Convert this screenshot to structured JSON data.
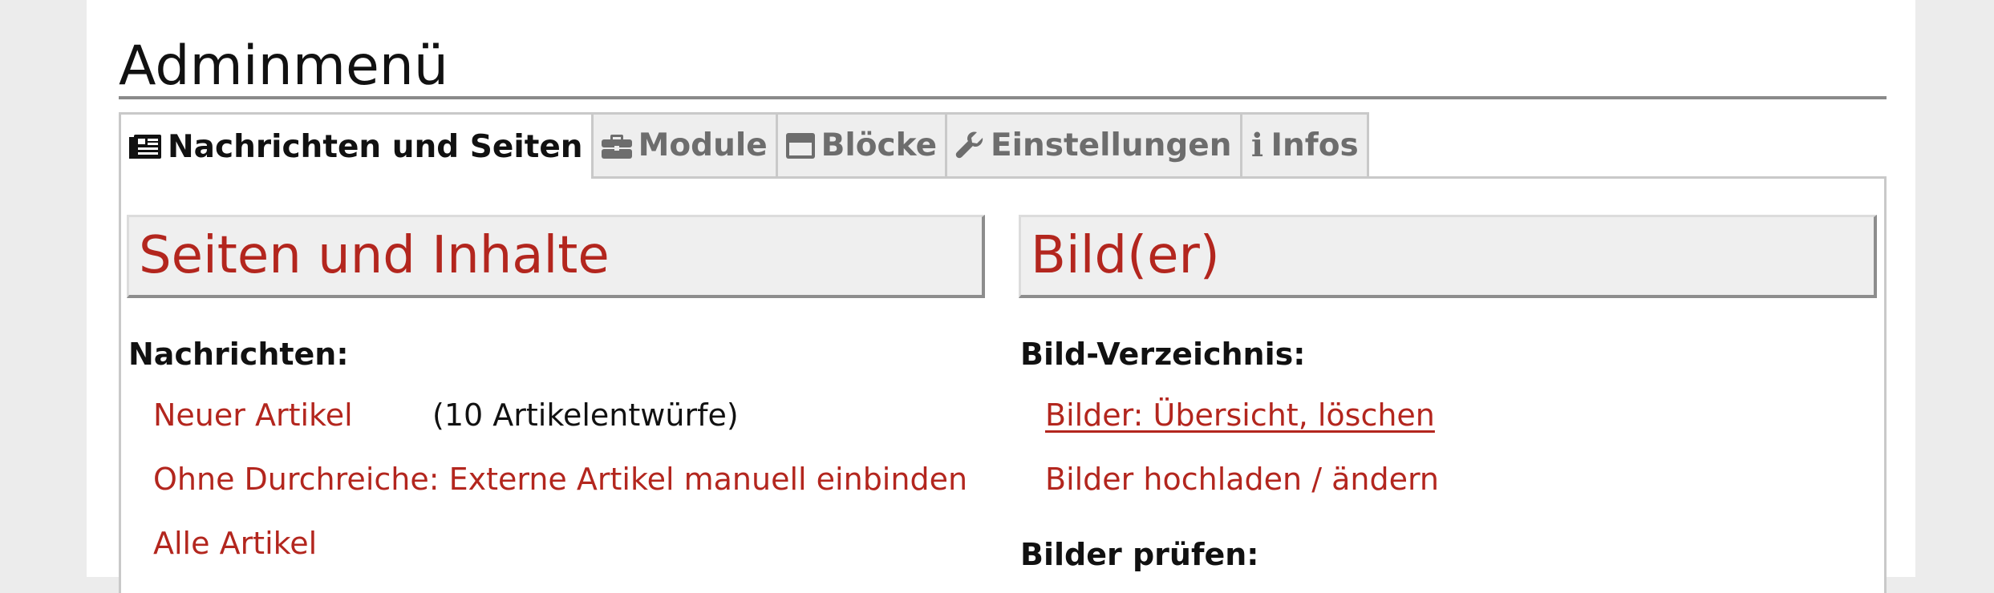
{
  "page_title": "Adminmenü",
  "tabs": [
    {
      "label": "Nachrichten und Seiten",
      "icon": "newspaper-icon",
      "active": true
    },
    {
      "label": "Module",
      "icon": "briefcase-icon",
      "active": false
    },
    {
      "label": "Blöcke",
      "icon": "window-icon",
      "active": false
    },
    {
      "label": "Einstellungen",
      "icon": "wrench-icon",
      "active": false
    },
    {
      "label": "Infos",
      "icon": "info-icon",
      "active": false
    }
  ],
  "left_column": {
    "heading": "Seiten und Inhalte",
    "section_label": "Nachrichten:",
    "links": [
      {
        "label": "Neuer Artikel",
        "note": "(10 Artikelentwürfe)"
      },
      {
        "label": "Ohne Durchreiche: Externe Artikel manuell einbinden"
      },
      {
        "label": "Alle Artikel"
      }
    ]
  },
  "right_column": {
    "heading": "Bild(er)",
    "section_label": "Bild-Verzeichnis:",
    "links": [
      {
        "label": "Bilder: Übersicht, löschen"
      },
      {
        "label": "Bilder hochladen / ändern"
      }
    ],
    "section_label_2": "Bilder prüfen:"
  },
  "colors": {
    "accent_red": "#b3261e",
    "tab_inactive_text": "#6d6d6d",
    "background": "#ececec"
  }
}
